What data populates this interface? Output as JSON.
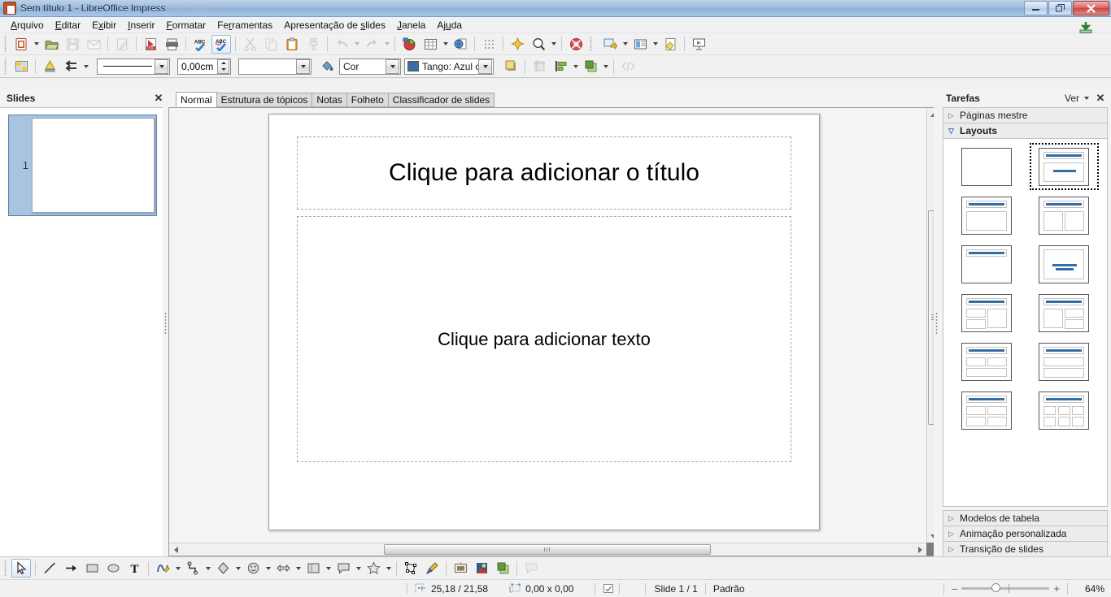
{
  "window": {
    "title": "Sem título 1 - LibreOffice Impress",
    "ghost": "Sem título",
    "minimize": "–",
    "restore": "❐",
    "close": "✕"
  },
  "menubar": {
    "items": [
      {
        "label": "Arquivo",
        "key": "A"
      },
      {
        "label": "Editar",
        "key": "E"
      },
      {
        "label": "Exibir",
        "key": "x"
      },
      {
        "label": "Inserir",
        "key": "I"
      },
      {
        "label": "Formatar",
        "key": "F"
      },
      {
        "label": "Ferramentas",
        "key": "r"
      },
      {
        "label": "Apresentação de slides",
        "key": "s"
      },
      {
        "label": "Janela",
        "key": "J"
      },
      {
        "label": "Ajuda",
        "key": "u"
      }
    ]
  },
  "standard_toolbar": {
    "buttons": [
      {
        "name": "new-document",
        "title": "Novo"
      },
      {
        "name": "open-document",
        "title": "Abrir"
      },
      {
        "name": "save-document",
        "title": "Salvar"
      },
      {
        "name": "email-document",
        "title": "Enviar por e-mail"
      },
      {
        "name": "edit-file",
        "title": "Editar arquivo"
      },
      {
        "name": "export-pdf",
        "title": "Exportar como PDF"
      },
      {
        "name": "print-document",
        "title": "Imprimir"
      },
      {
        "name": "spelling-check",
        "title": "Verificação ortográfica"
      },
      {
        "name": "autospellcheck",
        "title": "Autoverificação ortográfica"
      },
      {
        "name": "cut",
        "title": "Cortar"
      },
      {
        "name": "copy",
        "title": "Copiar"
      },
      {
        "name": "paste",
        "title": "Colar"
      },
      {
        "name": "clone-formatting",
        "title": "Clonar formatação"
      },
      {
        "name": "undo",
        "title": "Desfazer"
      },
      {
        "name": "redo",
        "title": "Refazer"
      },
      {
        "name": "chart",
        "title": "Gráfico"
      },
      {
        "name": "table",
        "title": "Tabela"
      },
      {
        "name": "hyperlink",
        "title": "Hyperlink"
      },
      {
        "name": "display-grid",
        "title": "Exibir grade"
      },
      {
        "name": "gallery",
        "title": "Galeria"
      },
      {
        "name": "zoom",
        "title": "Zoom"
      },
      {
        "name": "help",
        "title": "Ajuda"
      },
      {
        "name": "new-slide",
        "title": "Novo slide"
      },
      {
        "name": "slide-layout",
        "title": "Layout de slide"
      },
      {
        "name": "slide-design",
        "title": "Modelo de slide"
      },
      {
        "name": "start-slideshow",
        "title": "Iniciar apresentação"
      }
    ]
  },
  "line_fill_toolbar": {
    "line_style_value": "",
    "line_width_value": "0,00cm",
    "line_color_value": "",
    "fill_style_value": "Cor",
    "fill_color_value": "Tango: Azul c",
    "fill_color_hex": "#3a6ea5",
    "buttons": [
      {
        "name": "display-views",
        "title": "Exibições"
      },
      {
        "name": "line-arrow-styles",
        "title": "Estilos de seta"
      },
      {
        "name": "shadow",
        "title": "Sombra"
      },
      {
        "name": "crop",
        "title": "Cortar"
      },
      {
        "name": "align-objects",
        "title": "Alinhar"
      },
      {
        "name": "arrange",
        "title": "Dispor"
      },
      {
        "name": "points",
        "title": "Pontos"
      }
    ]
  },
  "slides_panel": {
    "title": "Slides",
    "close": "✕",
    "slides": [
      {
        "number": "1"
      }
    ]
  },
  "view_tabs": {
    "tabs": [
      {
        "label": "Normal",
        "selected": true
      },
      {
        "label": "Estrutura de tópicos",
        "selected": false
      },
      {
        "label": "Notas",
        "selected": false
      },
      {
        "label": "Folheto",
        "selected": false
      },
      {
        "label": "Classificador de slides",
        "selected": false
      }
    ]
  },
  "slide": {
    "title_placeholder": "Clique para adicionar o título",
    "body_placeholder": "Clique para adicionar texto"
  },
  "tasks_panel": {
    "title": "Tarefas",
    "view_label": "Ver",
    "close": "✕",
    "sections": [
      {
        "label": "Páginas mestre",
        "expanded": false
      },
      {
        "label": "Layouts",
        "expanded": true
      },
      {
        "label": "Modelos de tabela",
        "expanded": false
      },
      {
        "label": "Animação personalizada",
        "expanded": false
      },
      {
        "label": "Transição de slides",
        "expanded": false
      }
    ],
    "layouts": [
      {
        "name": "blank-slide",
        "kind": "blank",
        "selected": false
      },
      {
        "name": "title-content",
        "kind": "title-center",
        "selected": true
      },
      {
        "name": "title-one-content",
        "kind": "title-one",
        "selected": false
      },
      {
        "name": "title-two-content",
        "kind": "title-two",
        "selected": false
      },
      {
        "name": "title-only",
        "kind": "title-only",
        "selected": false
      },
      {
        "name": "centered-text",
        "kind": "centered-text",
        "selected": false
      },
      {
        "name": "title-two-left-one-right",
        "kind": "two-left-one-right",
        "selected": false
      },
      {
        "name": "title-one-left-two-right",
        "kind": "one-left-two-right",
        "selected": false
      },
      {
        "name": "title-two-top-one-bottom",
        "kind": "two-top-one-bottom",
        "selected": false
      },
      {
        "name": "title-one-top-two-bottom",
        "kind": "one-top-two-bottom",
        "selected": false
      },
      {
        "name": "title-four-content",
        "kind": "four",
        "selected": false
      },
      {
        "name": "title-six-content",
        "kind": "six",
        "selected": false
      }
    ]
  },
  "draw_toolbar": {
    "buttons": [
      {
        "name": "select-tool",
        "title": "Seleção",
        "active": true
      },
      {
        "name": "line-tool",
        "title": "Linha"
      },
      {
        "name": "line-arrow-tool",
        "title": "Linha com seta"
      },
      {
        "name": "rectangle-tool",
        "title": "Retângulo"
      },
      {
        "name": "ellipse-tool",
        "title": "Elipse"
      },
      {
        "name": "text-tool",
        "title": "Caixa de texto"
      },
      {
        "name": "curve-tool",
        "title": "Curva"
      },
      {
        "name": "connector-tool",
        "title": "Conector"
      },
      {
        "name": "basic-shapes-tool",
        "title": "Formas simples"
      },
      {
        "name": "symbol-shapes-tool",
        "title": "Formas de símbolos"
      },
      {
        "name": "block-arrows-tool",
        "title": "Setas cheias"
      },
      {
        "name": "flowchart-tool",
        "title": "Fluxogramas"
      },
      {
        "name": "callout-tool",
        "title": "Textos explicativos"
      },
      {
        "name": "stars-tool",
        "title": "Estrelas"
      },
      {
        "name": "points-tool",
        "title": "Pontos"
      },
      {
        "name": "glue-points-tool",
        "title": "Pontos de colagem"
      },
      {
        "name": "from-file-tool",
        "title": "A partir de arquivo"
      },
      {
        "name": "gallery-tool",
        "title": "Galeria"
      },
      {
        "name": "rotate-tool",
        "title": "Girar"
      },
      {
        "name": "interaction-tool",
        "title": "Interação"
      }
    ]
  },
  "statusbar": {
    "cursor_position": "25,18 / 21,58",
    "object_size": "0,00 x 0,00",
    "slide_info": "Slide 1 / 1",
    "master_name": "Padrão",
    "zoom_percent": "64%",
    "zoom_minus": "–",
    "zoom_plus": "+"
  }
}
